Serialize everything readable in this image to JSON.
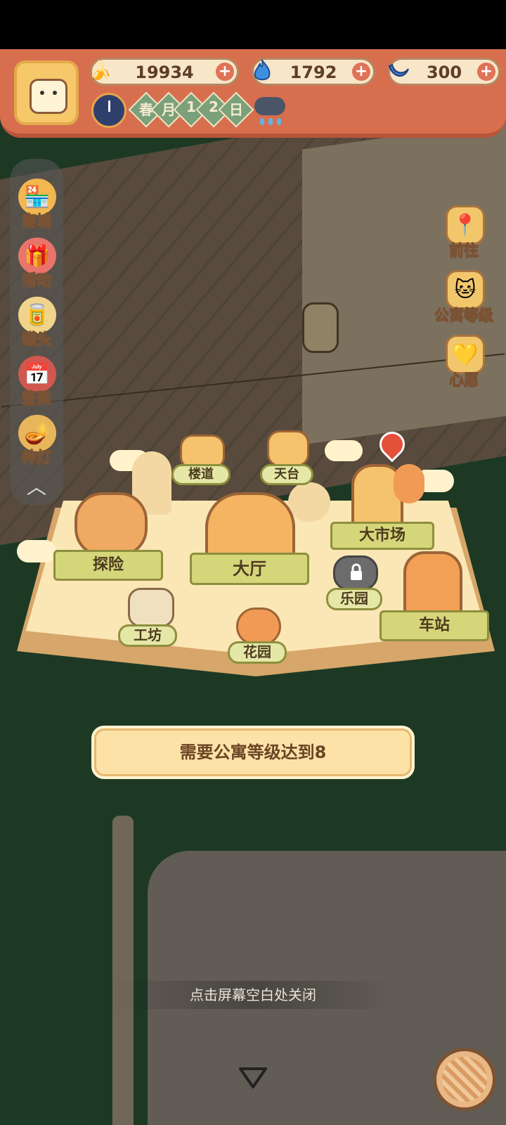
{
  "hud": {
    "currencies": [
      {
        "icon": "banana-icon",
        "value": "19934"
      },
      {
        "icon": "blue-flame-icon",
        "value": "1792"
      },
      {
        "icon": "blue-banana-icon",
        "value": "300"
      }
    ],
    "date": {
      "season": "春",
      "month_char": "月",
      "day_digits": [
        "1",
        "2"
      ],
      "day_char": "日"
    },
    "weather": "rain-cloud-icon"
  },
  "left_menu": [
    {
      "label": "商城",
      "icon": "shop-icon"
    },
    {
      "label": "活动",
      "icon": "gift-icon"
    },
    {
      "label": "罐头",
      "icon": "can-icon"
    },
    {
      "label": "签到",
      "icon": "calendar-icon"
    },
    {
      "label": "神灯",
      "icon": "magic-lamp-icon"
    }
  ],
  "right_menu": [
    {
      "label": "前往",
      "icon": "map-pin-icon"
    },
    {
      "label": "公寓等级",
      "icon": "apartment-badge-icon"
    },
    {
      "label": "心愿",
      "icon": "heart-book-icon"
    }
  ],
  "map": {
    "corridor": "楼道",
    "rooftop": "天台",
    "hall": "大厅",
    "explore": "探险",
    "market": "大市场",
    "workshop": "工坊",
    "garden": "花园",
    "park": "乐园",
    "station": "车站"
  },
  "notice": "需要公寓等级达到8",
  "close_hint": "点击屏幕空白处关闭",
  "colors": {
    "hud": "#d76f4f",
    "ribbon": "#d5d67a",
    "notice_bg": "#fde2a8"
  }
}
